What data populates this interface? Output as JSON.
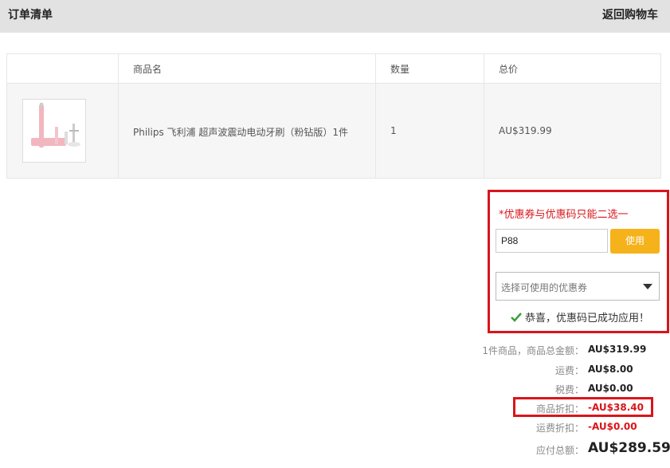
{
  "header": {
    "title": "订单清单",
    "back_link": "返回购物车"
  },
  "table": {
    "columns": [
      "商品名",
      "数量",
      "总价"
    ],
    "rows": [
      {
        "name": "Philips 飞利浦 超声波震动电动牙刷（粉钻版）1件",
        "qty": "1",
        "total": "AU$319.99"
      }
    ]
  },
  "coupon": {
    "hint": "*优惠券与优惠码只能二选一",
    "code_value": "P88",
    "use_button": "使用",
    "select_placeholder": "选择可使用的优惠券",
    "success_message": "恭喜，优惠码已成功应用！"
  },
  "summary": {
    "items_total_label": "1件商品，商品总金额：",
    "items_total_value": "AU$319.99",
    "shipping_label": "运费：",
    "shipping_value": "AU$8.00",
    "tax_label": "税费：",
    "tax_value": "AU$0.00",
    "discount_label": "商品折扣：",
    "discount_value": "-AU$38.40",
    "shipping_discount_label": "运费折扣：",
    "shipping_discount_value": "-AU$0.00",
    "payable_label": "应付总额：",
    "payable_value": "AU$289.59"
  },
  "colors": {
    "accent_red": "#d9151b",
    "button_yellow": "#f5b21b",
    "check_green": "#3c9e3c"
  }
}
